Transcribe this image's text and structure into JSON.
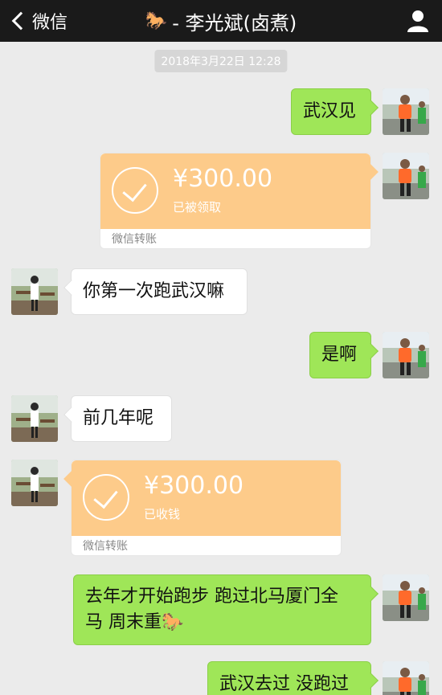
{
  "header": {
    "back_label": "微信",
    "horse_emoji": "🐎",
    "title": "- 李光斌(卤煮)"
  },
  "timestamp": "2018年3月22日 12:28",
  "messages": [
    {
      "type": "text",
      "side": "right",
      "text": "武汉见"
    },
    {
      "type": "transfer",
      "side": "right",
      "amount": "¥300.00",
      "status": "已被领取",
      "footer": "微信转账"
    },
    {
      "type": "text",
      "side": "left",
      "text": "你第一次跑武汉嘛"
    },
    {
      "type": "text",
      "side": "right",
      "text": "是啊"
    },
    {
      "type": "text",
      "side": "left",
      "text": "前几年呢"
    },
    {
      "type": "transfer",
      "side": "left",
      "amount": "¥300.00",
      "status": "已收钱",
      "footer": "微信转账"
    },
    {
      "type": "text",
      "side": "right",
      "line1": "去年才开始跑步 跑过北马厦门全",
      "line2": "马 周末重",
      "emoji": "🐎"
    },
    {
      "type": "text",
      "side": "right",
      "text": "武汉去过 没跑过"
    }
  ],
  "colors": {
    "navbar": "#1a1a1a",
    "background": "#ebebeb",
    "bubble_green": "#9fe658",
    "bubble_white": "#ffffff",
    "transfer_orange": "#fdcb8a"
  }
}
